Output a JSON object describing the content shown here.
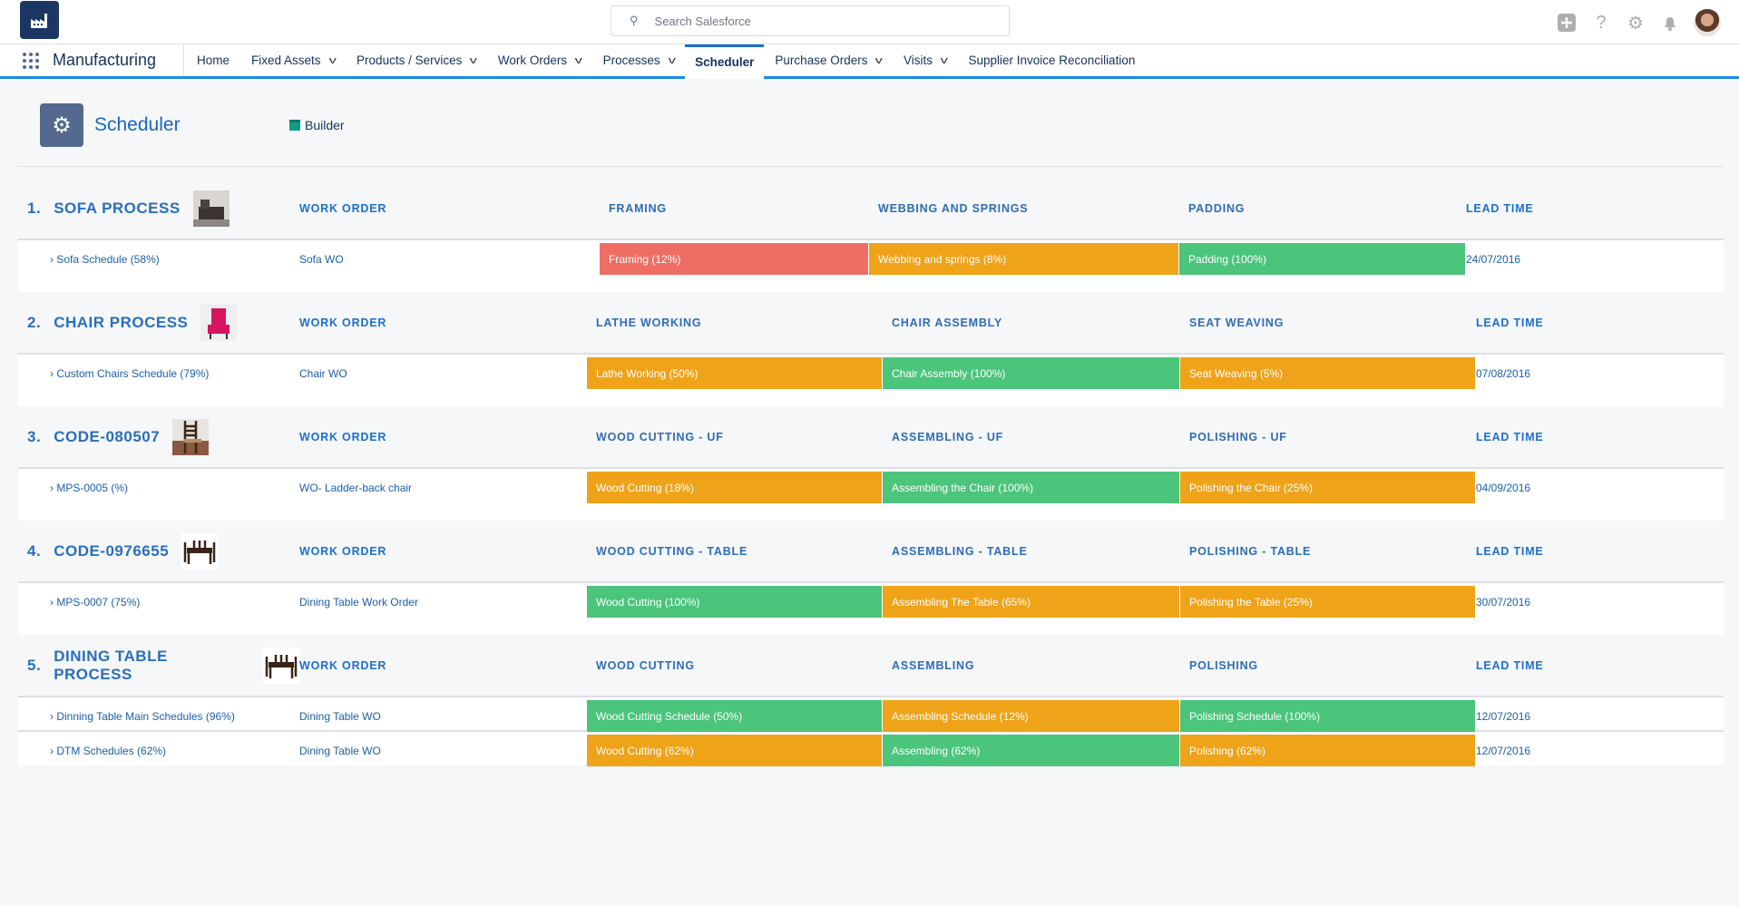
{
  "header": {
    "search_placeholder": "Search Salesforce",
    "icons": [
      "plus-icon",
      "help-icon",
      "gear-icon",
      "bell-icon",
      "avatar"
    ]
  },
  "nav": {
    "app_name": "Manufacturing",
    "items": [
      {
        "label": "Home",
        "dropdown": false
      },
      {
        "label": "Fixed Assets",
        "dropdown": true
      },
      {
        "label": "Products / Services",
        "dropdown": true
      },
      {
        "label": "Work Orders",
        "dropdown": true
      },
      {
        "label": "Processes",
        "dropdown": true
      },
      {
        "label": "Scheduler",
        "dropdown": false,
        "active": true
      },
      {
        "label": "Purchase Orders",
        "dropdown": true
      },
      {
        "label": "Visits",
        "dropdown": true
      },
      {
        "label": "Supplier Invoice Reconciliation",
        "dropdown": false
      }
    ]
  },
  "page": {
    "title": "Scheduler",
    "builder_label": "Builder"
  },
  "colors": {
    "red": "#ef6e64",
    "orange": "#efa319",
    "green": "#4bc47c"
  },
  "sections": [
    {
      "number": "1.",
      "title": "SOFA PROCESS",
      "thumb": "sofa",
      "columns": [
        "WORK ORDER",
        "FRAMING",
        "WEBBING AND SPRINGS",
        "PADDING",
        "LEAD TIME"
      ],
      "rows": [
        {
          "schedule": "› Sofa Schedule (58%)",
          "work_order": "Sofa WO",
          "stages": [
            {
              "label": "Framing (12%)",
              "color": "red"
            },
            {
              "label": "Webbing and springs (8%)",
              "color": "orange"
            },
            {
              "label": "Padding (100%)",
              "color": "green"
            }
          ],
          "lead_time": "24/07/2016"
        }
      ]
    },
    {
      "number": "2.",
      "title": "CHAIR PROCESS",
      "thumb": "chair",
      "columns": [
        "WORK ORDER",
        "LATHE WORKING",
        "CHAIR ASSEMBLY",
        "SEAT WEAVING",
        "LEAD TIME"
      ],
      "rows": [
        {
          "schedule": "› Custom Chairs Schedule (79%)",
          "work_order": "Chair WO",
          "stages": [
            {
              "label": "Lathe Working (50%)",
              "color": "orange"
            },
            {
              "label": "Chair Assembly (100%)",
              "color": "green"
            },
            {
              "label": "Seat Weaving (5%)",
              "color": "orange"
            }
          ],
          "lead_time": "07/08/2016"
        }
      ]
    },
    {
      "number": "3.",
      "title": "CODE-080507",
      "thumb": "ladder-chair",
      "columns": [
        "WORK ORDER",
        "WOOD CUTTING - UF",
        "ASSEMBLING - UF",
        "POLISHING - UF",
        "LEAD TIME"
      ],
      "rows": [
        {
          "schedule": "› MPS-0005 (%)",
          "work_order": "WO- Ladder-back chair",
          "stages": [
            {
              "label": "Wood Cutting (18%)",
              "color": "orange"
            },
            {
              "label": "Assembling the Chair (100%)",
              "color": "green"
            },
            {
              "label": "Polishing the Chair (25%)",
              "color": "orange"
            }
          ],
          "lead_time": "04/09/2016"
        }
      ]
    },
    {
      "number": "4.",
      "title": "CODE-0976655",
      "thumb": "dining-table",
      "columns": [
        "WORK ORDER",
        "WOOD CUTTING - TABLE",
        "ASSEMBLING - TABLE",
        "POLISHING - TABLE",
        "LEAD TIME"
      ],
      "rows": [
        {
          "schedule": "› MPS-0007 (75%)",
          "work_order": "Dining Table Work Order",
          "stages": [
            {
              "label": "Wood Cutting (100%)",
              "color": "green"
            },
            {
              "label": "Assembling The Table (65%)",
              "color": "orange"
            },
            {
              "label": "Polishing the Table (25%)",
              "color": "orange"
            }
          ],
          "lead_time": "30/07/2016"
        }
      ]
    },
    {
      "number": "5.",
      "title": "DINING TABLE PROCESS",
      "thumb": "dining-table",
      "columns": [
        "WORK ORDER",
        "WOOD CUTTING",
        "ASSEMBLING",
        "POLISHING",
        "LEAD TIME"
      ],
      "rows": [
        {
          "schedule": "› Dinning Table Main Schedules (96%)",
          "work_order": "Dining Table WO",
          "stages": [
            {
              "label": "Wood Cutting Schedule (50%)",
              "color": "green"
            },
            {
              "label": "Assembling Schedule (12%)",
              "color": "orange"
            },
            {
              "label": "Polishing Schedule (100%)",
              "color": "green"
            }
          ],
          "lead_time": "12/07/2016"
        },
        {
          "schedule": "› DTM Schedules (62%)",
          "work_order": "Dining Table WO",
          "stages": [
            {
              "label": "Wood Cutting (62%)",
              "color": "orange"
            },
            {
              "label": "Assembling (62%)",
              "color": "green"
            },
            {
              "label": "Polishing (62%)",
              "color": "orange"
            }
          ],
          "lead_time": "12/07/2016"
        }
      ]
    }
  ]
}
